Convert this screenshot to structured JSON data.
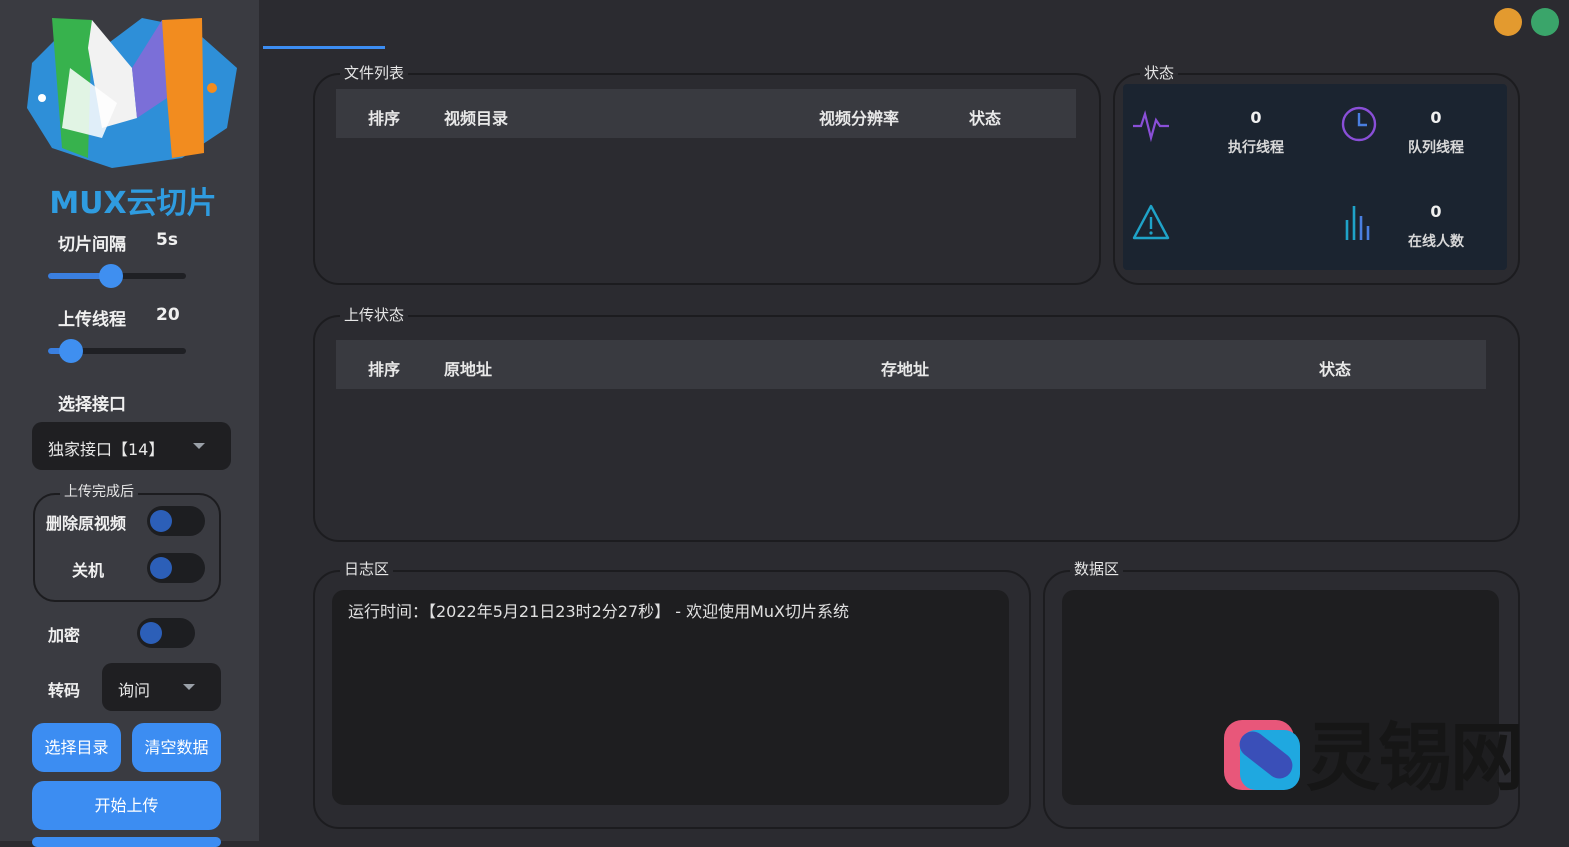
{
  "sidebar": {
    "logo": {
      "brand_text": "MUX云切片"
    },
    "slice_interval": {
      "label": "切片间隔",
      "value": "5s",
      "level": 0.45
    },
    "upload_threads": {
      "label": "上传线程",
      "value": "20",
      "level": 0.1
    },
    "select_api": {
      "label": "选择接口",
      "selected": "独家接口【14】"
    },
    "after_upload": {
      "title": "上传完成后",
      "delete_original": "删除原视频",
      "shutdown": "关机"
    },
    "encrypt": {
      "label": "加密"
    },
    "transcode": {
      "label": "转码",
      "selected": "询问"
    },
    "buttons": {
      "select_dir": "选择目录",
      "clear_data": "清空数据",
      "start_upload": "开始上传"
    }
  },
  "file_list": {
    "title": "文件列表",
    "columns": [
      "排序",
      "视频目录",
      "视频分辨率",
      "状态"
    ]
  },
  "status": {
    "title": "状态",
    "items": [
      {
        "icon": "pulse-icon",
        "value": "0",
        "label": "执行线程"
      },
      {
        "icon": "clock-icon",
        "value": "0",
        "label": "队列线程"
      },
      {
        "icon": "warning-icon",
        "value": "",
        "label": ""
      },
      {
        "icon": "bars-icon",
        "value": "0",
        "label": "在线人数"
      }
    ]
  },
  "upload_status": {
    "title": "上传状态",
    "columns": [
      "排序",
      "原地址",
      "存地址",
      "状态"
    ]
  },
  "log": {
    "title": "日志区",
    "lines": [
      "运行时间：【2022年5月21日23时2分27秒】 - 欢迎使用MuX切片系统"
    ]
  },
  "data_area": {
    "title": "数据区"
  },
  "watermark": {
    "text": "灵锡网"
  },
  "colors": {
    "accent": "#3c8df2",
    "window_min": "#e39a2f",
    "window_max": "#3aa56a",
    "status_icon_purple": "#8a4fd8",
    "status_icon_cyan": "#1fa3c8"
  }
}
